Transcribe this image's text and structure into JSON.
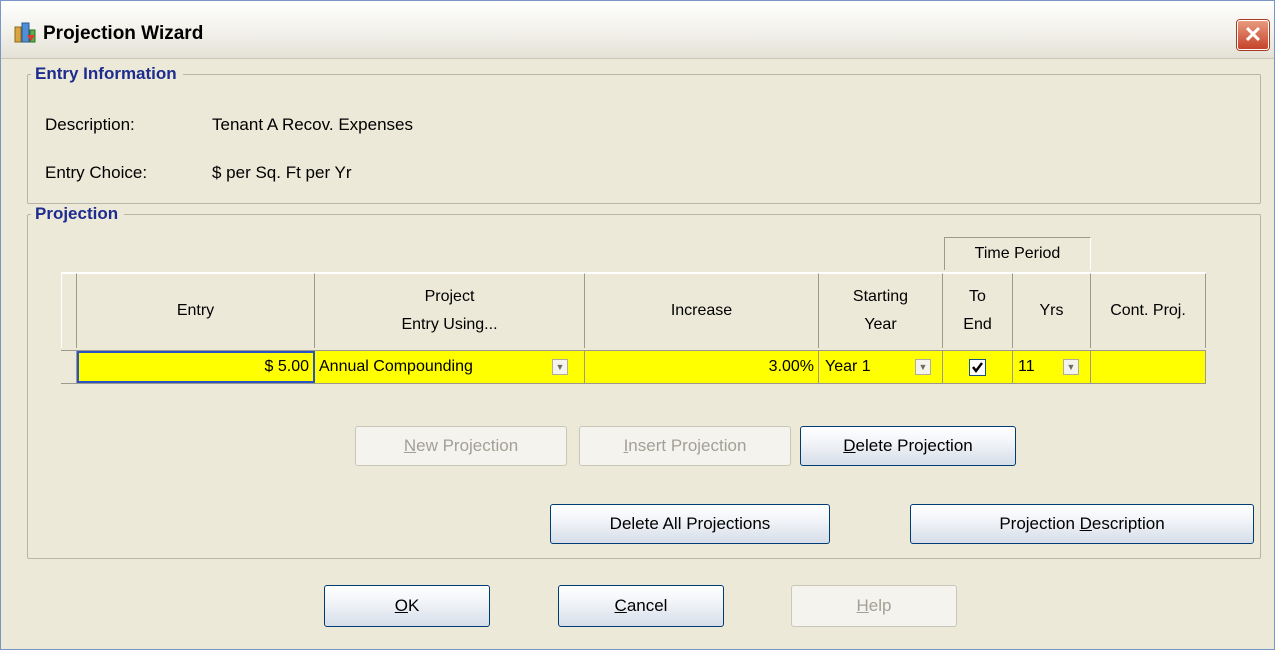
{
  "window": {
    "title": "Projection Wizard"
  },
  "entry_info": {
    "title": "Entry Information",
    "description_label": "Description:",
    "description_value": "Tenant A Recov. Expenses",
    "choice_label": "Entry Choice:",
    "choice_value": "$ per Sq. Ft per Yr"
  },
  "projection": {
    "title": "Projection",
    "time_period_label": "Time Period",
    "columns": {
      "entry": "Entry",
      "project_1": "Project",
      "project_2": "Entry Using...",
      "increase": "Increase",
      "starting_1": "Starting",
      "starting_2": "Year",
      "toend_1": "To",
      "toend_2": "End",
      "yrs": "Yrs",
      "cont": "Cont. Proj."
    },
    "row": {
      "entry": "$ 5.00",
      "method": "Annual Compounding",
      "increase": "3.00%",
      "starting_year": "Year 1",
      "to_end": true,
      "yrs": "11",
      "cont": ""
    }
  },
  "buttons": {
    "new_projection": {
      "pre": "",
      "u": "N",
      "post": "ew Projection"
    },
    "insert_projection": {
      "pre": "",
      "u": "I",
      "post": "nsert Projection"
    },
    "delete_projection": {
      "pre": "",
      "u": "D",
      "post": "elete Projection"
    },
    "delete_all": "Delete All Projections",
    "projection_description": {
      "pre": "Projection ",
      "u": "D",
      "post": "escription"
    },
    "ok": {
      "pre": "",
      "u": "O",
      "post": "K"
    },
    "cancel": {
      "pre": "",
      "u": "C",
      "post": "ancel"
    },
    "help": {
      "pre": "",
      "u": "H",
      "post": "elp"
    }
  },
  "colors": {
    "row_highlight": "#ffff00",
    "group_title": "#1d2c8e",
    "close_button": "#c5432b"
  },
  "icons": {
    "app": "buildings-icon",
    "close": "close-icon",
    "dropdown": "chevron-down-icon",
    "checkbox": "checkmark-icon"
  }
}
